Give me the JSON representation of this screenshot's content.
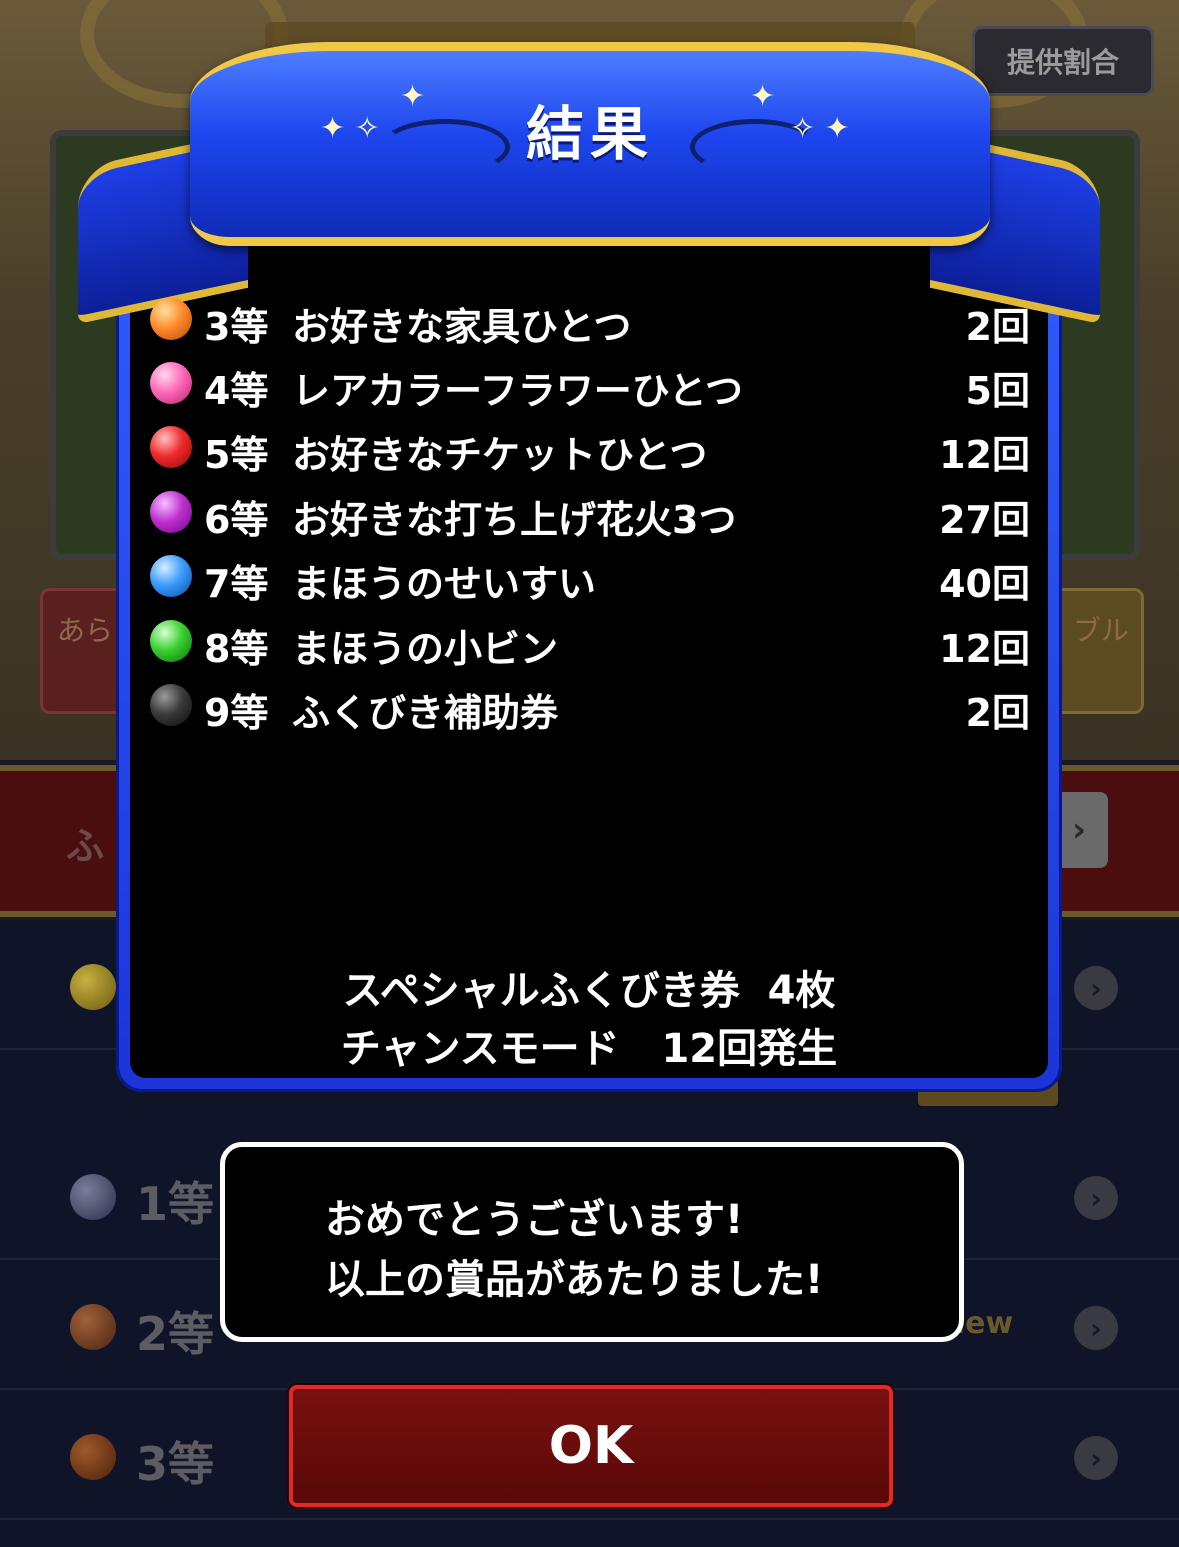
{
  "background": {
    "rate_button_label": "提供割合",
    "left_button_label": "あら",
    "right_button_label": "ブル",
    "redbar_label": "ふ",
    "new_badge": "New",
    "list_rows": [
      {
        "rank": "1等",
        "orb_color": "#3a3e5a"
      },
      {
        "rank": "2等",
        "orb_color": "#6a3a20"
      },
      {
        "rank": "3等",
        "orb_color": "#6a3a18"
      }
    ]
  },
  "result": {
    "title": "結果",
    "prizes": [
      {
        "rank": "3等",
        "name": "お好きな家具ひとつ",
        "count": "2回",
        "orb_color": "#ff8a2a"
      },
      {
        "rank": "4等",
        "name": "レアカラーフラワーひとつ",
        "count": "5回",
        "orb_color": "#ff6ab8"
      },
      {
        "rank": "5等",
        "name": "お好きなチケットひとつ",
        "count": "12回",
        "orb_color": "#ee2a2a"
      },
      {
        "rank": "6等",
        "name": "お好きな打ち上げ花火3つ",
        "count": "27回",
        "orb_color": "#c030d0"
      },
      {
        "rank": "7等",
        "name": "まほうのせいすい",
        "count": "40回",
        "orb_color": "#3a9cff"
      },
      {
        "rank": "8等",
        "name": "まほうの小ビン",
        "count": "12回",
        "orb_color": "#3ad030"
      },
      {
        "rank": "9等",
        "name": "ふくびき補助券",
        "count": "2回",
        "orb_color": "#3a3a3a"
      }
    ],
    "summary_line1": "スペシャルふくびき券  4枚",
    "summary_line2": "チャンスモード   12回発生"
  },
  "message": {
    "line1": "おめでとうございます!",
    "line2": "以上の賞品があたりました!"
  },
  "ok_button_label": "OK"
}
